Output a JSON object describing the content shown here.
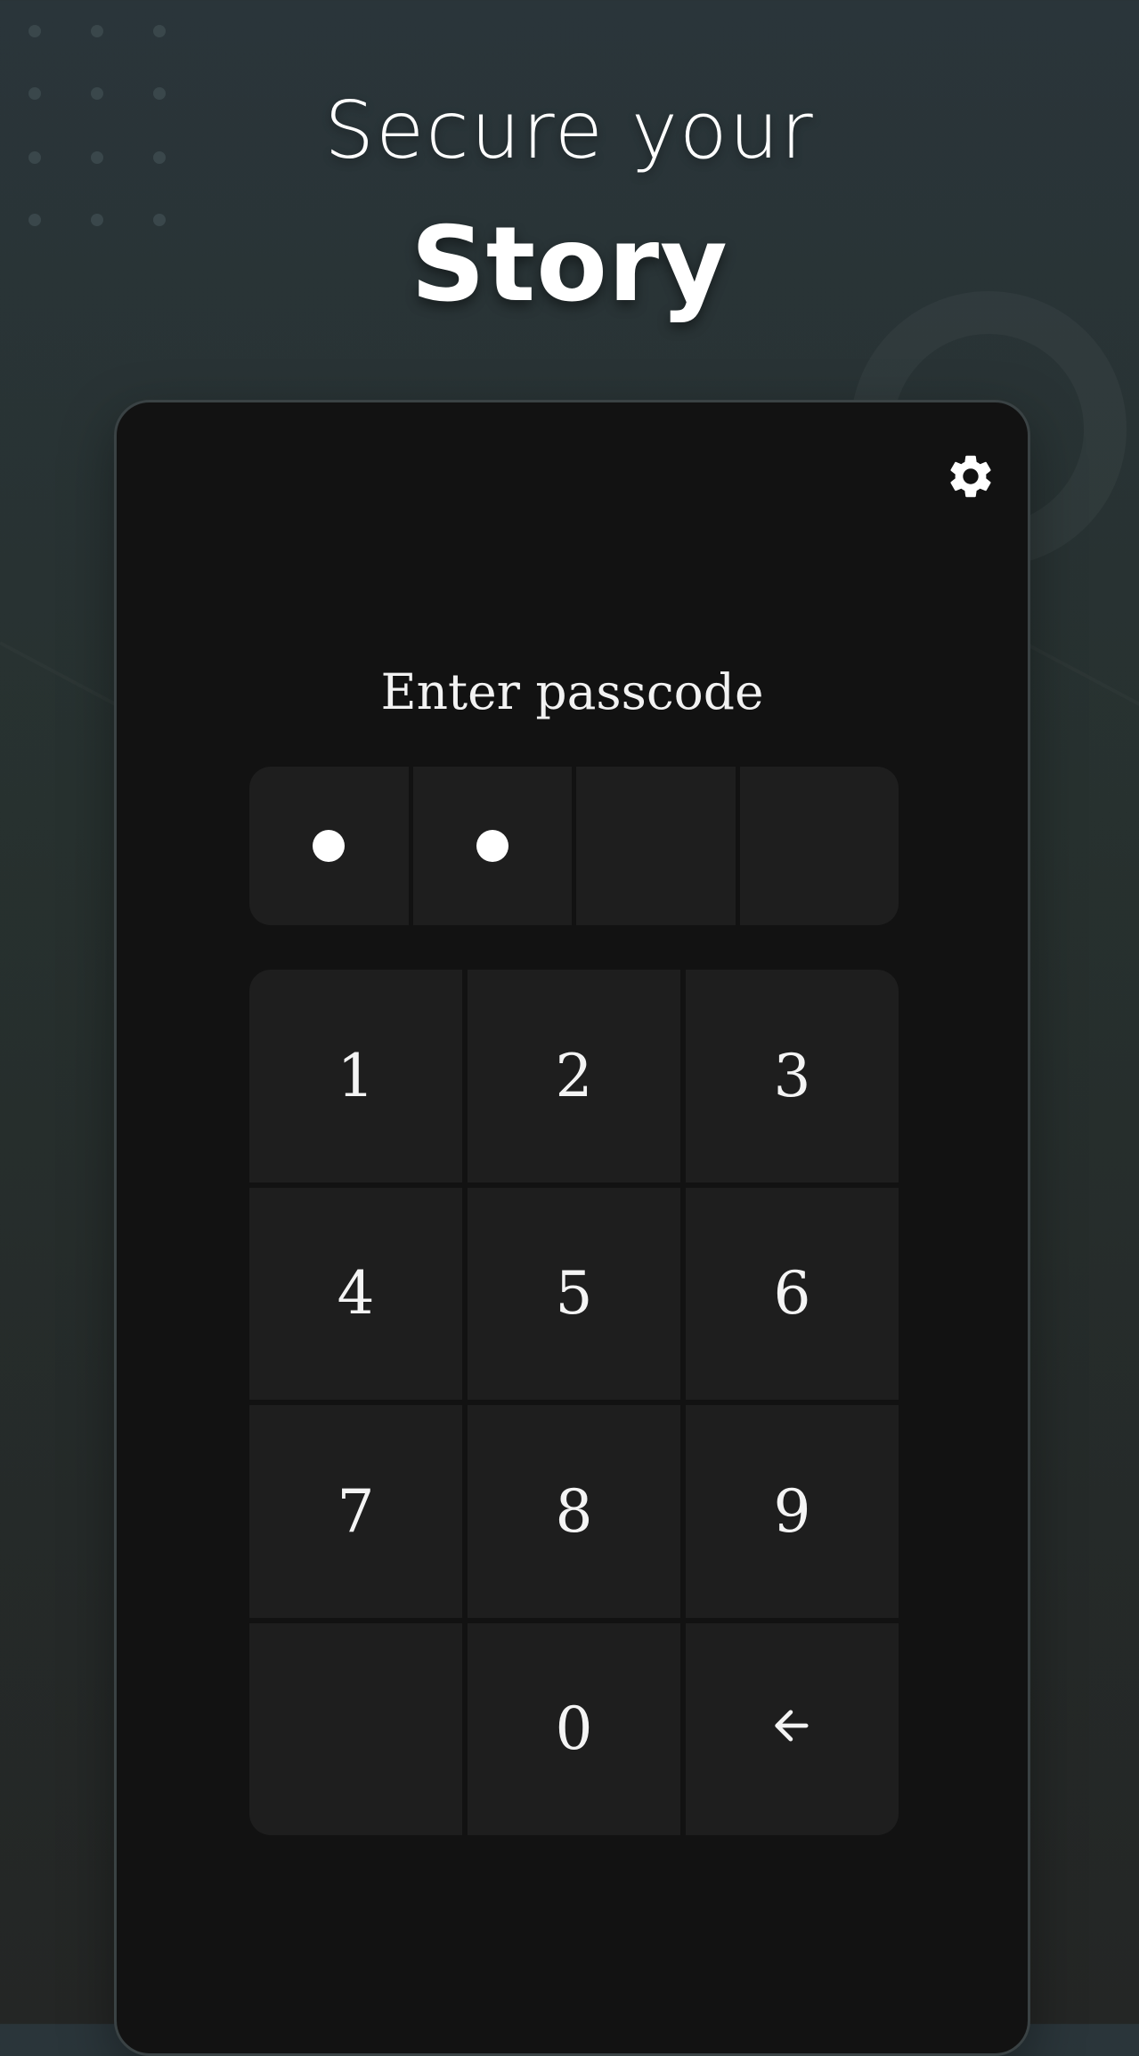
{
  "header": {
    "tagline": "Secure your",
    "brand": "Story"
  },
  "lock_screen": {
    "settings_icon": "gear-icon",
    "prompt": "Enter passcode",
    "passcode": {
      "length": 4,
      "filled": 2
    },
    "keypad": {
      "keys": [
        "1",
        "2",
        "3",
        "4",
        "5",
        "6",
        "7",
        "8",
        "9",
        "",
        "0",
        "backspace"
      ],
      "backspace_icon": "arrow-left-icon"
    }
  },
  "colors": {
    "background": "#27312f",
    "panel": "#121212",
    "key": "#1e1e1e",
    "text": "#ffffff"
  }
}
